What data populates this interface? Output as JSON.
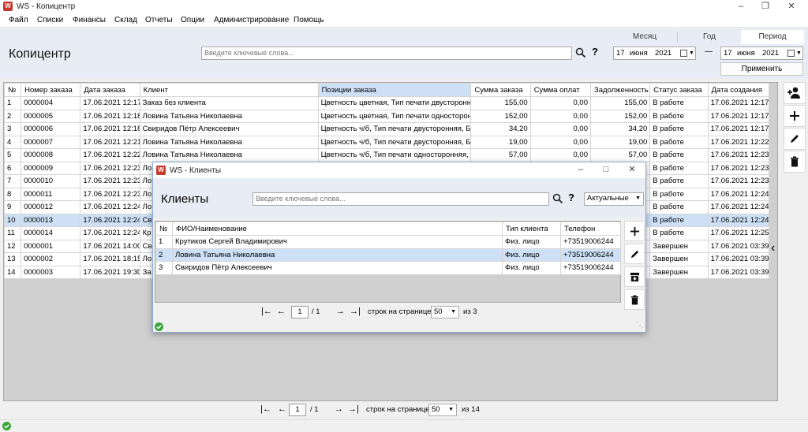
{
  "window": {
    "title": "WS - Копицентр",
    "icon_text": "W"
  },
  "menu": [
    "Файл",
    "Списки",
    "Финансы",
    "Склад",
    "Отчеты",
    "Опции",
    "Администрирование",
    "Помощь"
  ],
  "header": {
    "title": "Копицентр",
    "search_placeholder": "Введите ключевые слова...",
    "help": "?",
    "period_tabs": [
      "Месяц",
      "Год",
      "Период"
    ],
    "date_from": {
      "day": "17",
      "month": "июня",
      "year": "2021"
    },
    "date_dash": "—",
    "date_to": {
      "day": "17",
      "month": "июня",
      "year": "2021"
    },
    "apply": "Применить"
  },
  "orders": {
    "columns": [
      "№",
      "Номер заказа",
      "Дата заказа",
      "Клиент",
      "Позиции заказа",
      "Сумма заказа",
      "Сумма оплат",
      "Задолженность",
      "Статус заказа",
      "Дата создания"
    ],
    "rows": [
      [
        "1",
        "0000004",
        "17.06.2021 12:17",
        "Заказ без клиента",
        "Цветность цветная, Тип печати двусторонняя",
        "155,00",
        "0,00",
        "155,00",
        "В работе",
        "17.06.2021 12:17"
      ],
      [
        "2",
        "0000005",
        "17.06.2021 12:18",
        "Ловина Татьяна Николаевна",
        "Цветность цветная, Тип печати односторон",
        "152,00",
        "0,00",
        "152,00",
        "В работе",
        "17.06.2021 12:17"
      ],
      [
        "3",
        "0000006",
        "17.06.2021 12:18",
        "Свиридов Пётр Алексеевич",
        "Цветность ч/б, Тип печати двусторонняя, Бу",
        "34,20",
        "0,00",
        "34,20",
        "В работе",
        "17.06.2021 12:17"
      ],
      [
        "4",
        "0000007",
        "17.06.2021 12:21",
        "Ловина Татьяна Николаевна",
        "Цветность ч/б, Тип печати двусторонняя, Бу",
        "19,00",
        "0,00",
        "19,00",
        "В работе",
        "17.06.2021 12:22"
      ],
      [
        "5",
        "0000008",
        "17.06.2021 12:22",
        "Ловина Татьяна Николаевна",
        "Цветность ч/б, Тип печати односторонняя,",
        "57,00",
        "0,00",
        "57,00",
        "В работе",
        "17.06.2021 12:23"
      ],
      [
        "6",
        "0000009",
        "17.06.2021 12:23",
        "Ло",
        "",
        "",
        "",
        "",
        "В работе",
        "17.06.2021 12:23"
      ],
      [
        "7",
        "0000010",
        "17.06.2021 12:23",
        "Ло",
        "",
        "",
        "",
        "",
        "В работе",
        "17.06.2021 12:23"
      ],
      [
        "8",
        "0000011",
        "17.06.2021 12:23",
        "Ло",
        "",
        "",
        "",
        "",
        "В работе",
        "17.06.2021 12:24"
      ],
      [
        "9",
        "0000012",
        "17.06.2021 12:24",
        "Ло",
        "",
        "",
        "",
        "",
        "В работе",
        "17.06.2021 12:24"
      ],
      [
        "10",
        "0000013",
        "17.06.2021 12:24",
        "Св",
        "",
        "",
        "",
        "",
        "В работе",
        "17.06.2021 12:24"
      ],
      [
        "11",
        "0000014",
        "17.06.2021 12:24",
        "Кр",
        "",
        "",
        "",
        "",
        "В работе",
        "17.06.2021 12:25"
      ],
      [
        "12",
        "0000001",
        "17.06.2021 14:00",
        "Св",
        "",
        "",
        "",
        "",
        "Завершен",
        "17.06.2021 03:39"
      ],
      [
        "13",
        "0000002",
        "17.06.2021 18:15",
        "Ло",
        "",
        "",
        "",
        "",
        "Завершен",
        "17.06.2021 03:39"
      ],
      [
        "14",
        "0000003",
        "17.06.2021 19:30",
        "За",
        "",
        "",
        "",
        "",
        "Завершен",
        "17.06.2021 03:39"
      ]
    ],
    "selected_row": 9
  },
  "pager": {
    "page": "1",
    "total_pages": "/ 1",
    "rows_label": "строк на странице",
    "per_page": "50",
    "of_label": "из 14"
  },
  "dialog": {
    "title": "WS - Клиенты",
    "heading": "Клиенты",
    "search_placeholder": "Введите ключевые слова...",
    "help": "?",
    "filter": "Актуальные",
    "columns": [
      "№",
      "ФИО/Наименование",
      "Тип клиента",
      "Телефон"
    ],
    "rows": [
      [
        "1",
        "Крутиков Сергей Владимирович",
        "Физ. лицо",
        "+73519006244"
      ],
      [
        "2",
        "Ловина Татьяна Николаевна",
        "Физ. лицо",
        "+73519006244"
      ],
      [
        "3",
        "Свиридов Пётр Алексеевич",
        "Физ. лицо",
        "+73519006244"
      ]
    ],
    "selected_row": 1,
    "pager": {
      "page": "1",
      "total_pages": "/ 1",
      "rows_label": "строк на странице",
      "per_page": "50",
      "of_label": "из 3"
    }
  },
  "colors": {
    "accent": "#2e6fd0",
    "header_bg": "#e8edf5",
    "selection": "#cde0f5",
    "status_ok": "#3aa63a",
    "app_icon": "#c8372c"
  }
}
